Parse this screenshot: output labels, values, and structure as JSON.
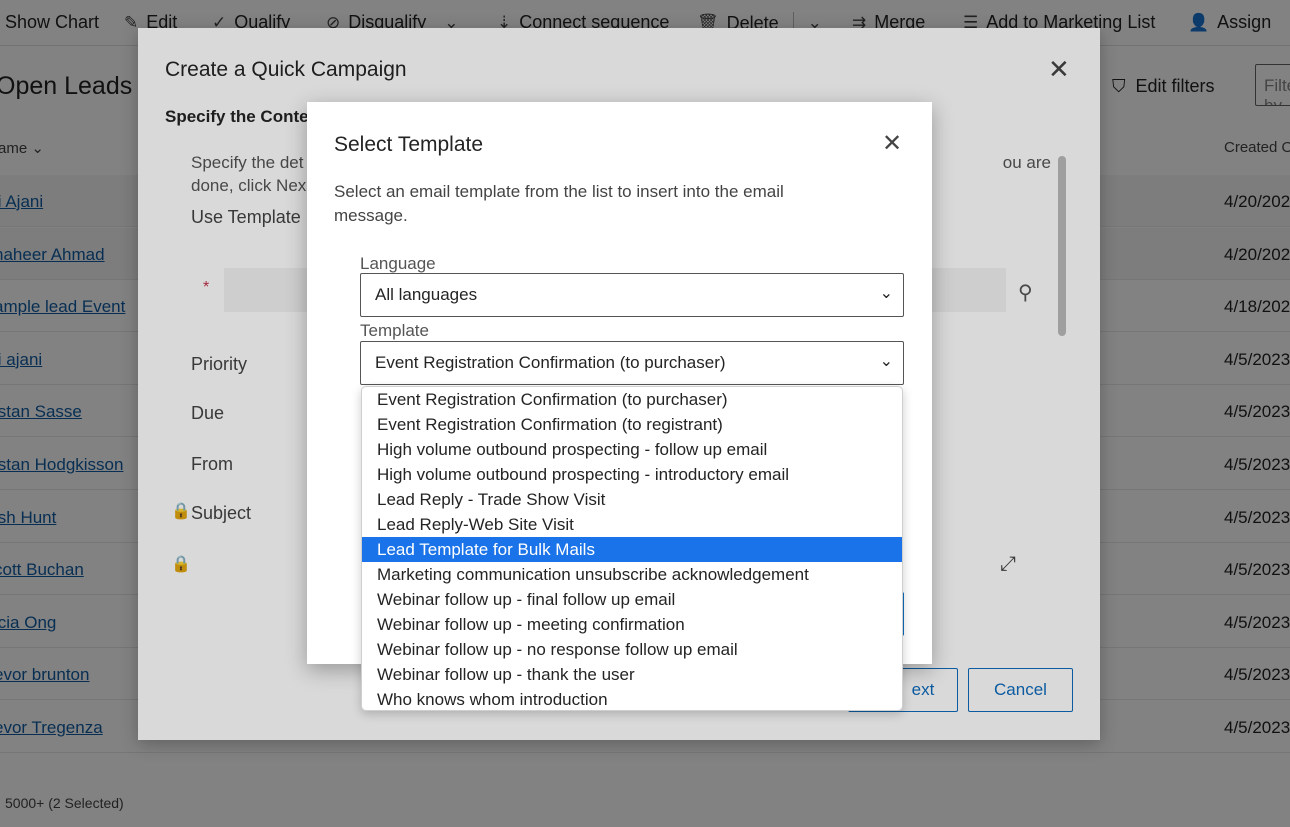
{
  "commandbar": {
    "show_chart": "Show Chart",
    "edit": "Edit",
    "qualify": "Qualify",
    "disqualify": "Disqualify",
    "connect_sequence": "Connect sequence",
    "delete": "Delete",
    "merge": "Merge",
    "add_to_marketing_list": "Add to Marketing List",
    "assign": "Assign"
  },
  "view": {
    "title": "Open Leads",
    "edit_filters": "Edit filters",
    "filter_placeholder": "Filter by keyword",
    "col_name": "ame",
    "col_created": "Created O",
    "rows": [
      {
        "name": "li Ajani",
        "created": "4/20/202"
      },
      {
        "name": "haheer Ahmad",
        "created": "4/20/202"
      },
      {
        "name": "ample lead Event",
        "created": "4/18/202"
      },
      {
        "name": "li ajani",
        "created": "4/5/2023"
      },
      {
        "name": "istan Sasse",
        "created": "4/5/2023"
      },
      {
        "name": "istan Hodgkisson",
        "created": "4/5/2023"
      },
      {
        "name": "ish Hunt",
        "created": "4/5/2023"
      },
      {
        "name": "cott Buchan",
        "created": "4/5/2023"
      },
      {
        "name": "icia Ong",
        "created": "4/5/2023"
      },
      {
        "name": "evor brunton",
        "created": "4/5/2023"
      },
      {
        "name": "evor Tregenza",
        "created": "4/5/2023"
      }
    ],
    "footer_status": "5000+ (2 Selected)"
  },
  "quick_campaign": {
    "title": "Create a Quick Campaign",
    "subheading": "Specify the Conte",
    "description_left": "Specify the det",
    "description_left2": "done, click Nex",
    "description_right": "ou are",
    "use_template": "Use Template",
    "required_mark": "*",
    "priority": "Priority",
    "due": "Due",
    "from": "From",
    "subject": "Subject",
    "next_label": "ext",
    "cancel_label": "Cancel"
  },
  "select_template": {
    "title": "Select Template",
    "description": "Select an email template from the list to insert into the email message.",
    "language_label": "Language",
    "language_value": "All languages",
    "template_label": "Template",
    "template_value": "Event Registration Confirmation (to purchaser)",
    "options": [
      "Event Registration Confirmation (to purchaser)",
      "Event Registration Confirmation (to registrant)",
      "High volume outbound prospecting - follow up email",
      "High volume outbound prospecting - introductory email",
      "Lead Reply - Trade Show Visit",
      "Lead Reply-Web Site Visit",
      "Lead Template for Bulk Mails",
      "Marketing communication unsubscribe acknowledgement",
      "Webinar follow up - final follow up email",
      "Webinar follow up - meeting confirmation",
      "Webinar follow up - no response follow up email",
      "Webinar follow up - thank the user",
      "Who knows whom introduction"
    ],
    "highlighted_option": "Lead Template for Bulk Mails"
  },
  "colors": {
    "link": "#115ea3",
    "highlight": "#1a73e8",
    "brand": "#0f6cbd",
    "required": "#c4314b"
  }
}
